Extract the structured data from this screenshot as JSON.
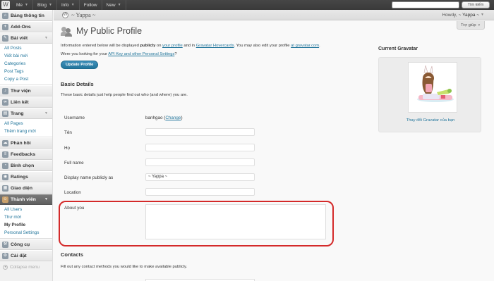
{
  "topbar": {
    "items": [
      {
        "label": "Me",
        "caret": true
      },
      {
        "label": "Blog",
        "caret": true
      },
      {
        "label": "Info",
        "caret": true
      },
      {
        "label": "Follow",
        "caret": false
      },
      {
        "label": "New",
        "caret": true
      }
    ],
    "search_placeholder": "",
    "search_button": "Tìm kiếm"
  },
  "site": {
    "name": "~ Yappa ~",
    "howdy_prefix": "Howdy,",
    "user": "~ Yappa ~",
    "help_tab": "Trợ giúp"
  },
  "sidebar": {
    "groups": [
      {
        "label": "Bảng thông tin",
        "icon": "dashboard-icon",
        "items": []
      },
      {
        "label": "Add-Ons",
        "icon": "addons-icon",
        "items": []
      },
      {
        "label": "Bài viết",
        "icon": "posts-icon",
        "arrow": true,
        "items": [
          "All Posts",
          "Viết bài mới",
          "Categories",
          "Post Tags",
          "Copy a Post"
        ]
      },
      {
        "label": "Thư viện",
        "icon": "media-icon",
        "items": []
      },
      {
        "label": "Liên kết",
        "icon": "links-icon",
        "items": []
      },
      {
        "label": "Trang",
        "icon": "pages-icon",
        "arrow": true,
        "items": [
          "All Pages",
          "Thêm trang mới"
        ]
      },
      {
        "label": "Phản hồi",
        "icon": "comments-icon",
        "items": []
      },
      {
        "label": "Feedbacks",
        "icon": "feedback-icon",
        "items": []
      },
      {
        "label": "Bình chọn",
        "icon": "polls-icon",
        "items": []
      },
      {
        "label": "Ratings",
        "icon": "ratings-icon",
        "items": []
      },
      {
        "label": "Giao diện",
        "icon": "appearance-icon",
        "items": []
      },
      {
        "label": "Thành viên",
        "icon": "users-icon",
        "arrow": true,
        "active": true,
        "items": [
          "All Users",
          "Thư mời",
          "My Profile",
          "Personal Settings"
        ],
        "current": "My Profile"
      },
      {
        "label": "Công cụ",
        "icon": "tools-icon",
        "items": []
      },
      {
        "label": "Cài đặt",
        "icon": "settings-icon",
        "items": []
      }
    ],
    "collapse": "Collapse menu"
  },
  "main": {
    "title": "My Public Profile",
    "intro": {
      "p1": "Information entered below will be displayed ",
      "bold": "publicly",
      "p2": " on ",
      "link1": "your profile",
      "p3": " and in ",
      "link2": "Gravatar Hovercards",
      "p4": ". You may also edit your profile ",
      "link3": "at gravatar.com",
      "p5": "."
    },
    "help_line": {
      "p1": "Were you looking for your ",
      "link": "API Key and other Personal Settings",
      "p2": "?"
    },
    "update_button": "Update Profile",
    "basic": {
      "heading": "Basic Details",
      "desc": "These basic details just help people find out who (and where) you are.",
      "username_label": "Username",
      "username_value": "banhgao",
      "change_link": "Change",
      "first_name_label": "Tên",
      "last_name_label": "Họ",
      "full_name_label": "Full name",
      "display_name_label": "Display name publicly as",
      "display_name_value": "~ Yappa ~",
      "location_label": "Location",
      "about_label": "About you"
    },
    "contacts": {
      "heading": "Contacts",
      "desc": "Fill out any contact methods you would like to make available publicly."
    }
  },
  "gravatar": {
    "heading": "Current Gravatar",
    "change_link": "Thay đổi Gravatar của bạn"
  },
  "colors": {
    "link": "#21759b",
    "highlight": "#d42a2a",
    "button": "#21759b"
  }
}
